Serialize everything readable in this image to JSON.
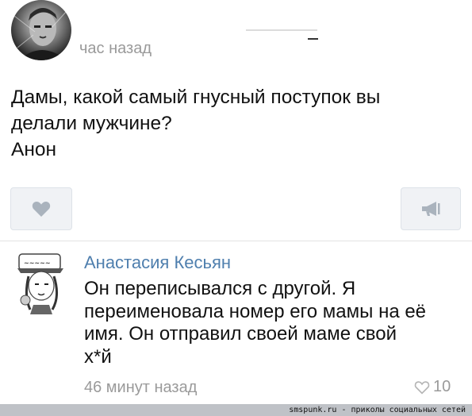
{
  "post": {
    "time": "час назад",
    "text_lines": [
      "Дамы, какой самый гнусный поступок вы",
      "делали мужчине?",
      "Анон"
    ],
    "like_icon": "heart-icon",
    "share_icon": "megaphone-icon"
  },
  "comment": {
    "author": "Анастасия Кесьян",
    "text_lines": [
      "Он переписывался с другой. Я",
      "переименовала номер его мамы на её",
      "имя. Он отправил своей маме свой",
      "х*й"
    ],
    "time": "46 минут назад",
    "likes": "10",
    "likes_icon": "heart-icon"
  },
  "watermark": "smspunk.ru - приколы социальных сетей",
  "colors": {
    "author_link": "#4f7fae",
    "muted_text": "#9a9a9a",
    "button_bg": "#f0f2f5",
    "icon_gray": "#aab3bd",
    "watermark_bg": "#bfc2c7"
  }
}
